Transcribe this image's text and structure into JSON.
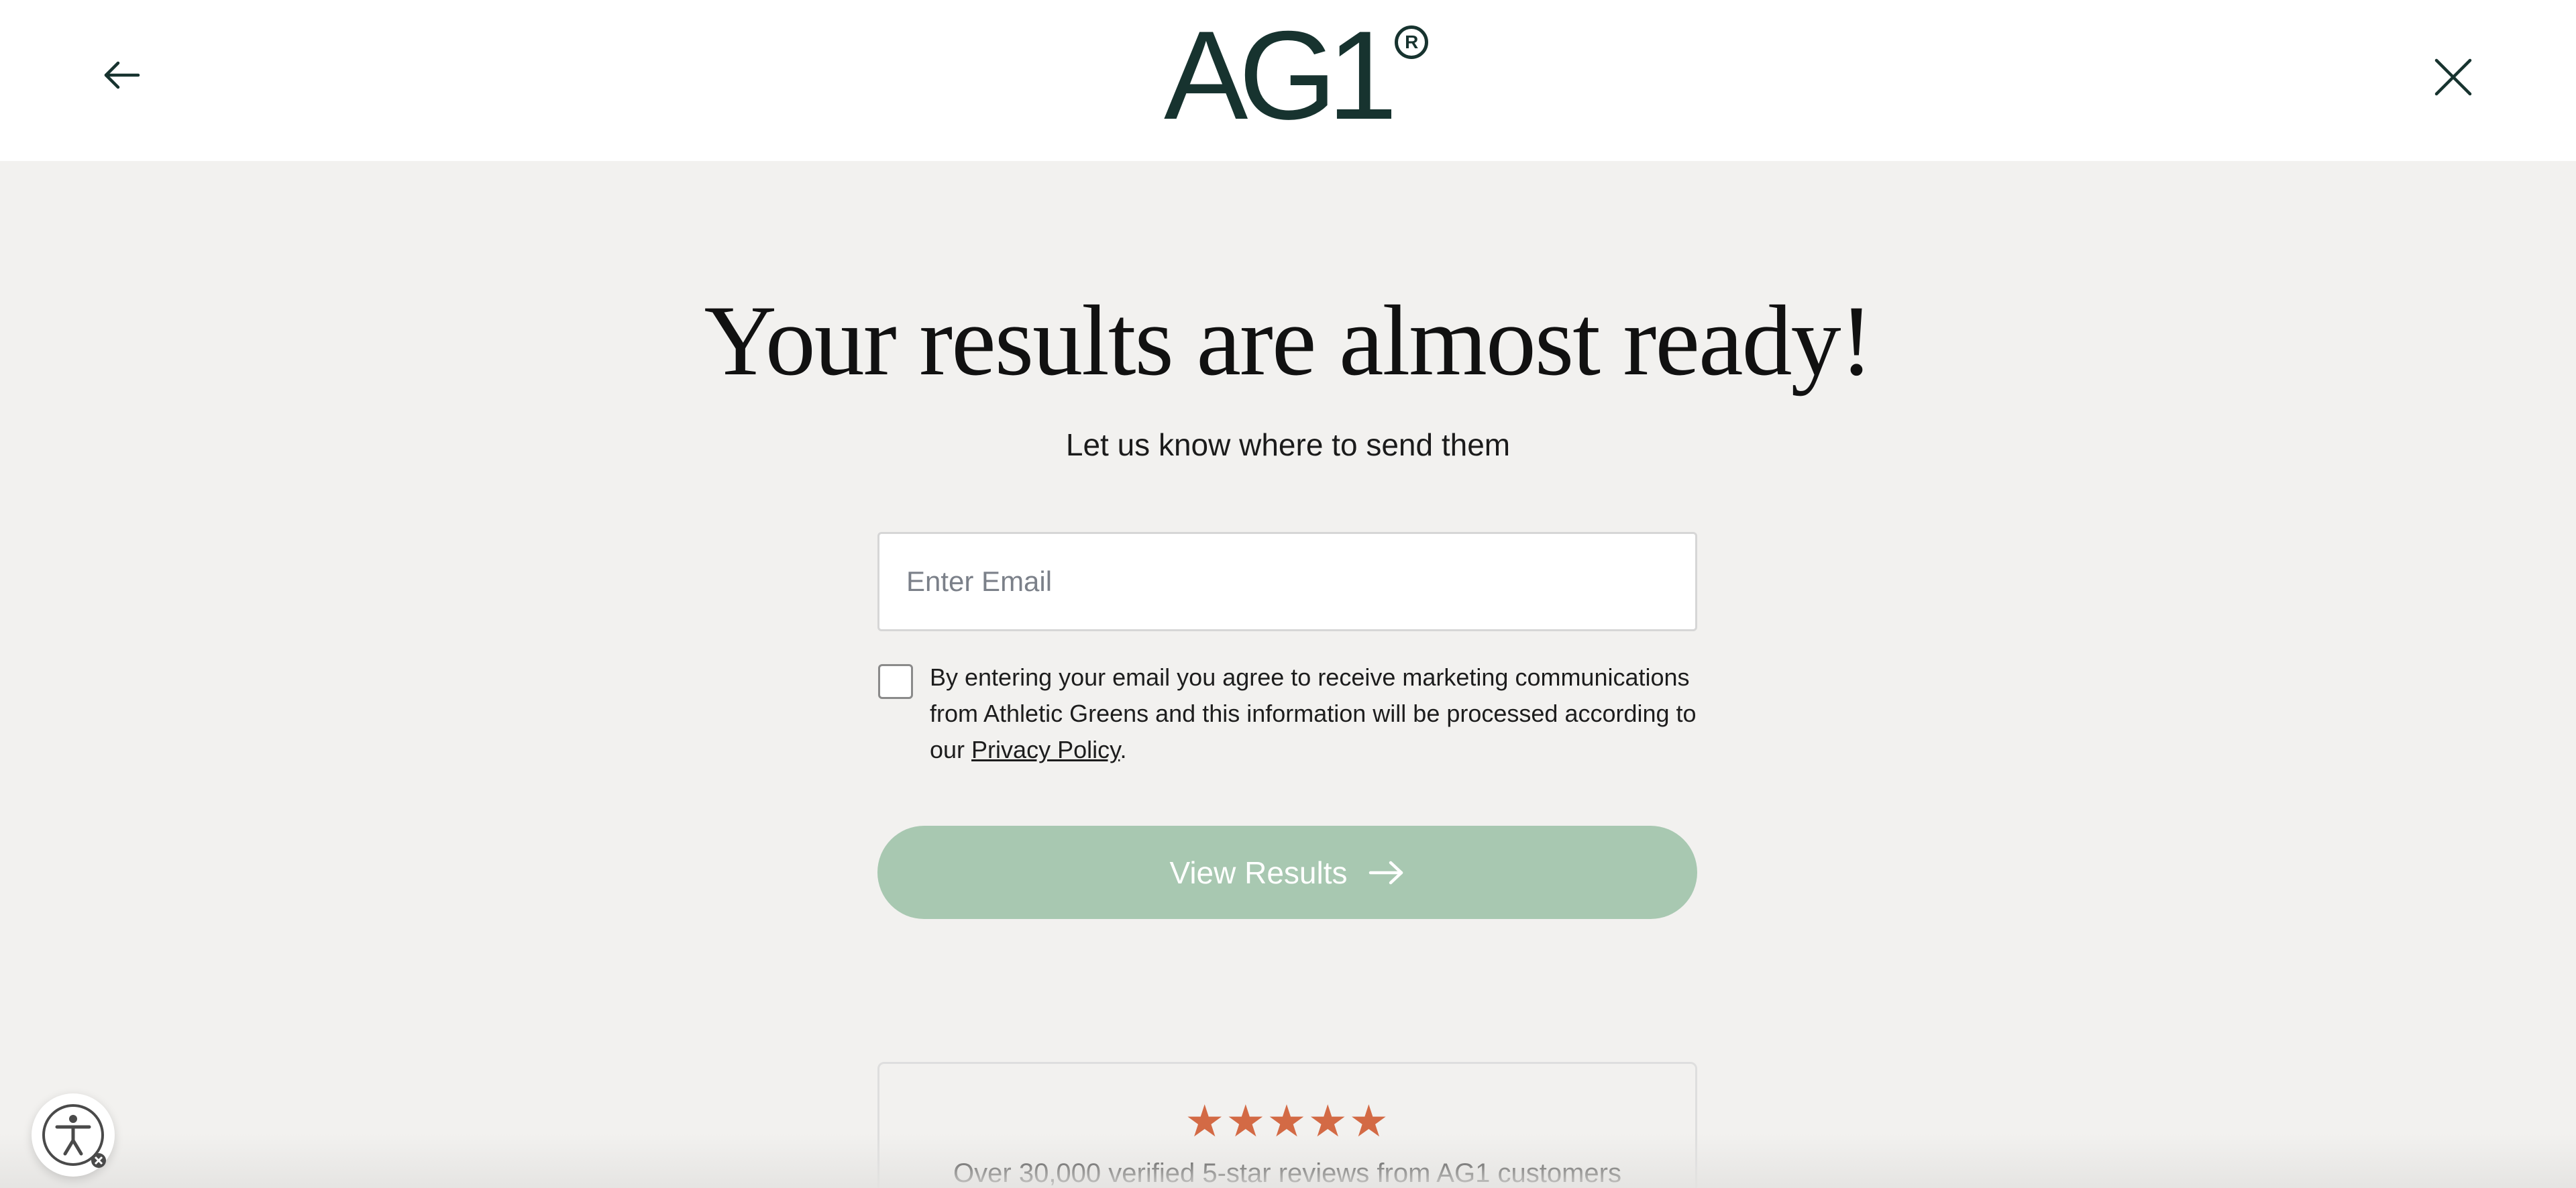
{
  "header": {
    "logo_text": "AG1",
    "logo_mark": "R",
    "back_icon": "arrow-left-icon",
    "close_icon": "close-icon"
  },
  "main": {
    "title": "Your results are almost ready!",
    "subtitle": "Let us know where to send them",
    "email": {
      "placeholder": "Enter Email",
      "value": ""
    },
    "consent": {
      "checked": false,
      "text_before": "By entering your email you agree to receive marketing communications from Athletic Greens and this information will be processed according to our ",
      "link_text": "Privacy Policy",
      "text_after": "."
    },
    "cta": {
      "label": "View Results",
      "icon": "arrow-right-icon"
    }
  },
  "reviews": {
    "stars": "★★★★★",
    "rating": 5,
    "text": "Over 30,000 verified 5-star reviews from AG1 customers"
  },
  "accessibility": {
    "icon": "accessibility-icon"
  },
  "colors": {
    "brand": "#17332f",
    "cta_background": "#a8c8b1",
    "star": "#d36a45",
    "page_background": "#f2f1ef"
  }
}
